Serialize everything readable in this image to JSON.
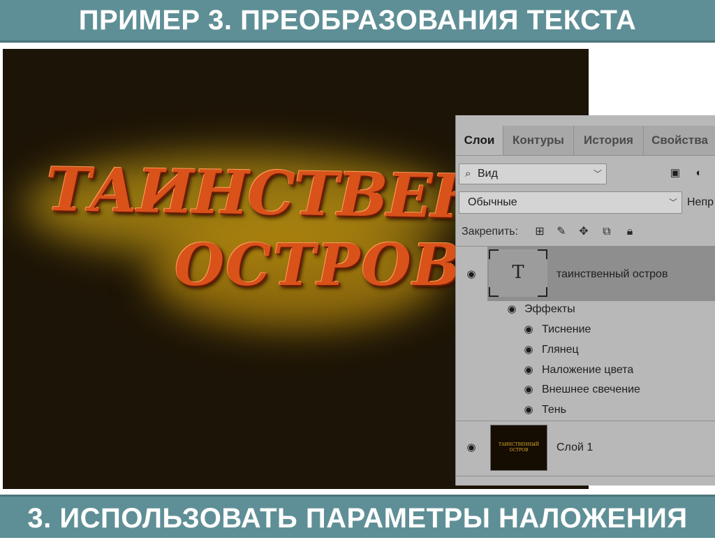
{
  "slide": {
    "title": "ПРИМЕР 3. ПРЕОБРАЗОВАНИЯ ТЕКСТА",
    "footer": "3. ИСПОЛЬЗОВАТЬ ПАРАМЕТРЫ НАЛОЖЕНИЯ"
  },
  "canvas": {
    "line1": "ТАИНСТВЕННЫ",
    "line2": "ОСТРОВ",
    "background_color": "#1c1406",
    "text_color": "#d8521a",
    "glow_color": "#c8a020"
  },
  "layers_panel": {
    "tabs": [
      "Слои",
      "Контуры",
      "История",
      "Свойства"
    ],
    "active_tab": "Слои",
    "filter": {
      "label": "Вид",
      "icon": "search-icon"
    },
    "filter_icons": [
      "image-filter-icon",
      "adjustment-filter-icon"
    ],
    "blend_mode": "Обычные",
    "opacity_label": "Непр",
    "lock_label": "Закрепить:",
    "lock_icons": [
      "lock-transparent-pixels-icon",
      "lock-image-pixels-icon",
      "lock-position-icon",
      "lock-artboard-icon",
      "lock-all-icon"
    ],
    "layers": [
      {
        "name": "таинственный остров",
        "type": "text",
        "thumb_glyph": "T",
        "selected": true,
        "effects_label": "Эффекты",
        "effects": [
          "Тиснение",
          "Глянец",
          "Наложение цвета",
          "Внешнее свечение",
          "Тень"
        ]
      },
      {
        "name": "Слой 1",
        "type": "raster",
        "thumb_line1": "ТАИНСТВЕННЫЙ",
        "thumb_line2": "ОСТРОВ",
        "selected": false
      }
    ]
  }
}
